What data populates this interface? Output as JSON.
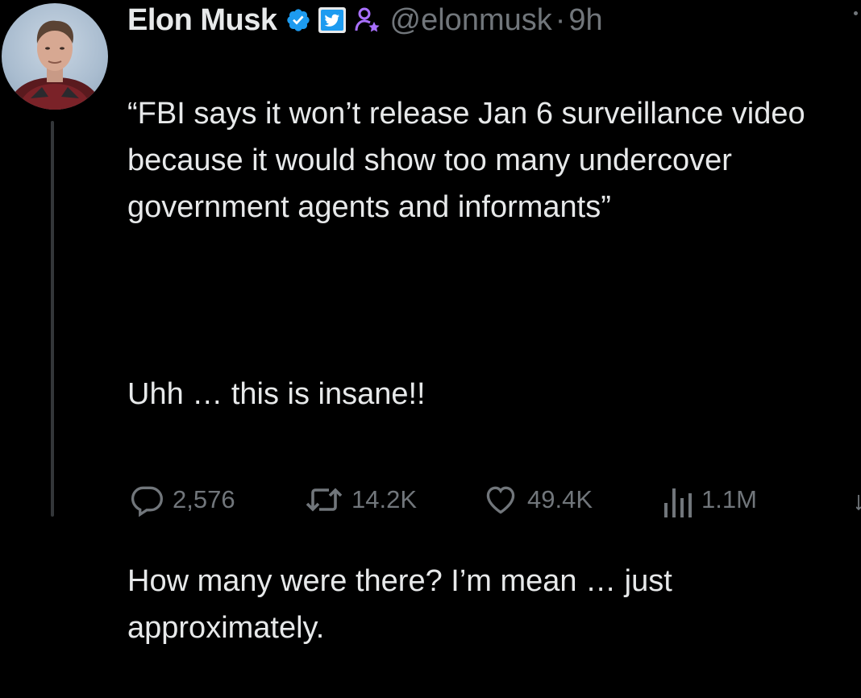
{
  "tweet": {
    "author": {
      "name": "Elon Musk",
      "handle": "@elonmusk",
      "separator": "·",
      "time": "9h",
      "badges": [
        "verified-badge-icon",
        "twitter-bird-icon",
        "business-person-icon"
      ],
      "avatar": "avatar-photo"
    },
    "paragraphs": [
      "“FBI says it won’t release Jan 6 surveillance video because it would show too many undercover government agents and informants”",
      "Uhh … this is insane!!",
      "How many were there? I’m mean … just approximately."
    ],
    "actions": {
      "replies": "2,576",
      "retweets": "14.2K",
      "likes": "49.4K",
      "views": "1.1M"
    }
  },
  "colors": {
    "background": "#000000",
    "text": "#e7e9ea",
    "muted": "#71767b",
    "verified": "#1d9bf0",
    "business": "#a970ff",
    "thread_line": "#333639"
  }
}
